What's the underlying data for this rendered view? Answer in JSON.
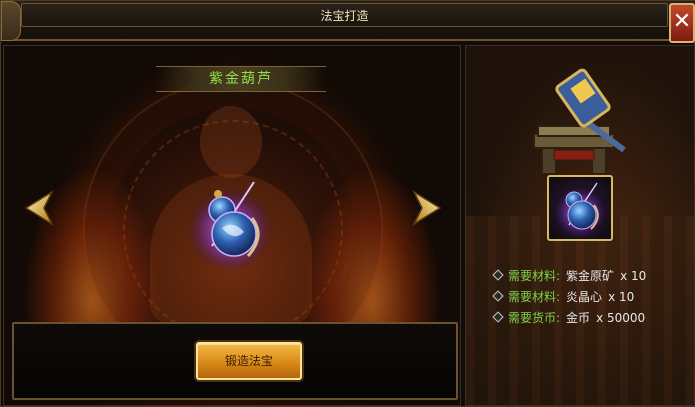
{
  "window": {
    "title": "法宝打造"
  },
  "item": {
    "name": "紫金葫芦"
  },
  "actions": {
    "forge_label": "锻造法宝"
  },
  "requirements": [
    {
      "label": "需要材料:",
      "value": "紫金原矿",
      "qty": "x 10"
    },
    {
      "label": "需要材料:",
      "value": "炎晶心",
      "qty": "x 10"
    },
    {
      "label": "需要货币:",
      "value": "金币",
      "qty": "x 50000"
    }
  ],
  "icons": {
    "close": "close-icon",
    "prev": "arrow-left-icon",
    "next": "arrow-right-icon",
    "item": "gourd-icon",
    "anvil": "anvil-hammer-icon"
  },
  "colors": {
    "item_name": "#8fe04a",
    "requirement_label": "#7fd349",
    "requirement_value": "#e8e8e8",
    "gold_button": "#d98a18",
    "frame_gold": "#d9b764"
  }
}
